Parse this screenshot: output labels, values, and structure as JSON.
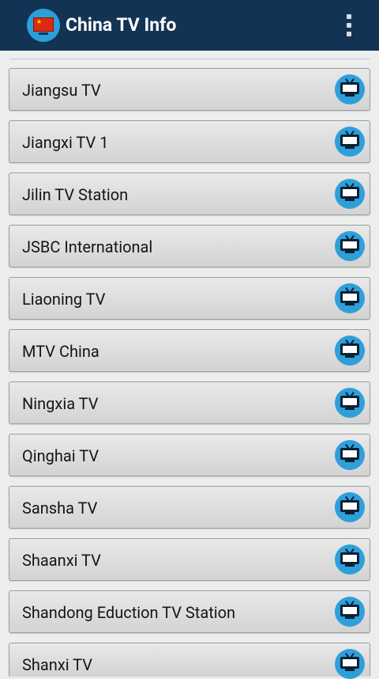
{
  "app": {
    "title": "China TV Info"
  },
  "channels": [
    {
      "label": "Jiangsu TV"
    },
    {
      "label": "Jiangxi TV 1"
    },
    {
      "label": "Jilin TV Station"
    },
    {
      "label": "JSBC International"
    },
    {
      "label": "Liaoning TV"
    },
    {
      "label": "MTV China"
    },
    {
      "label": "Ningxia TV"
    },
    {
      "label": "Qinghai TV"
    },
    {
      "label": "Sansha TV"
    },
    {
      "label": "Shaanxi TV"
    },
    {
      "label": "Shandong Eduction TV Station"
    },
    {
      "label": "Shanxi TV"
    }
  ],
  "icons": {
    "row": "tv-icon",
    "logo": "china-flag-tv-icon",
    "menu": "overflow-menu-icon"
  },
  "colors": {
    "appbar": "#133354",
    "accent": "#2f9fda",
    "background": "#eceded"
  }
}
